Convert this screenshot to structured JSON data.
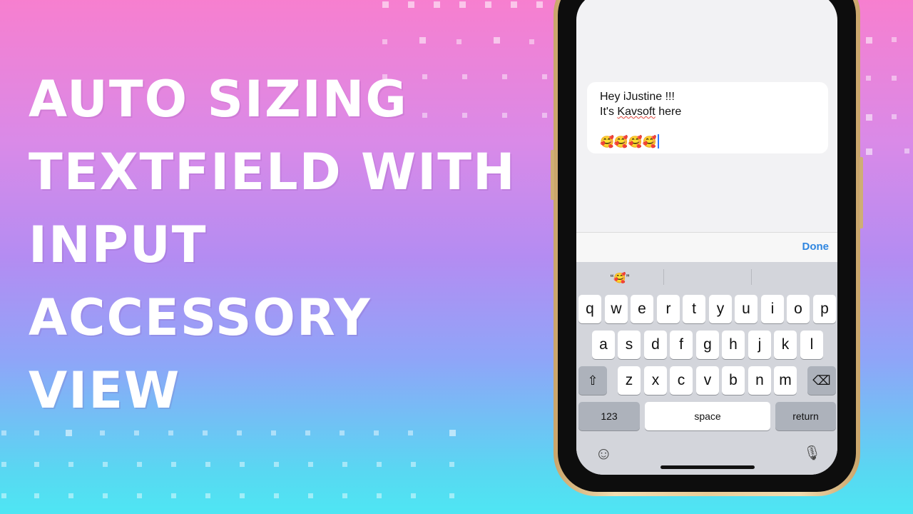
{
  "headline": {
    "lines": [
      "Auto Sizing",
      "TextField with",
      "Input",
      "Accessory",
      "View"
    ]
  },
  "text_field": {
    "line1": "Hey iJustine !!!",
    "line2_prefix": "It's ",
    "line2_misspelled": "Kavsoft",
    "line2_suffix": " here",
    "emoji_line": "🥰🥰🥰🥰"
  },
  "toolbar": {
    "done_label": "Done"
  },
  "suggestions": {
    "first": "“🥰”",
    "second": "",
    "third": ""
  },
  "keyboard": {
    "row1": [
      "q",
      "w",
      "e",
      "r",
      "t",
      "y",
      "u",
      "i",
      "o",
      "p"
    ],
    "row2": [
      "a",
      "s",
      "d",
      "f",
      "g",
      "h",
      "j",
      "k",
      "l"
    ],
    "row3": [
      "z",
      "x",
      "c",
      "v",
      "b",
      "n",
      "m"
    ],
    "shift_icon": "⇧",
    "delete_icon": "⌫",
    "numbers_label": "123",
    "space_label": "space",
    "return_label": "return",
    "emoji_icon": "☺",
    "mic_icon": "🎙"
  }
}
